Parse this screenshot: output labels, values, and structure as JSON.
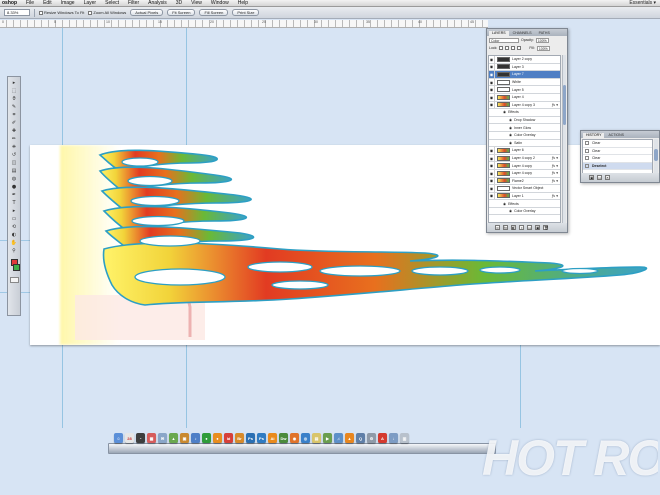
{
  "menubar": {
    "items": [
      "oshop",
      "File",
      "Edit",
      "Image",
      "Layer",
      "Select",
      "Filter",
      "Analysis",
      "3D",
      "View",
      "Window",
      "Help"
    ],
    "right": "Essentials ▾"
  },
  "options": {
    "zoom_value": "8.33%",
    "resize_windows_label": "Resize Windows To Fit",
    "zoom_all_windows_label": "Zoom All Windows",
    "buttons": [
      "Actual Pixels",
      "Fit Screen",
      "Fill Screen",
      "Print Size"
    ]
  },
  "ruler": {
    "labels": [
      "0",
      "5",
      "10",
      "15",
      "20",
      "25",
      "30",
      "35",
      "40",
      "45"
    ]
  },
  "tools": {
    "icons": [
      "move",
      "marquee",
      "lasso",
      "quick-select",
      "crop",
      "eyedropper",
      "healing",
      "brush",
      "stamp",
      "history-brush",
      "eraser",
      "gradient",
      "blur",
      "dodge",
      "pen",
      "type",
      "path-select",
      "shape",
      "3d-rotate",
      "3d-camera",
      "hand",
      "zoom"
    ],
    "glyphs": [
      "▸",
      "⬚",
      "ϑ",
      "✎",
      "⌗",
      "✐",
      "✚",
      "✏",
      "⎈",
      "↺",
      "◫",
      "▤",
      "◍",
      "●",
      "✒",
      "T",
      "▸",
      "▭",
      "⟲",
      "◐",
      "✋",
      "⚲"
    ],
    "fg_color": "#e0393b",
    "bg_color": "#3fae4a"
  },
  "layers_panel": {
    "tabs": [
      "LAYERS",
      "CHANNELS",
      "PATHS"
    ],
    "blend_mode": "Color",
    "opacity_label": "Opacity:",
    "opacity_value": "100%",
    "lock_label": "Lock:",
    "fill_label": "Fill:",
    "fill_value": "100%",
    "layers": [
      {
        "name": "Layer 2 copy",
        "thumb": "dark",
        "fx": false,
        "selected": false,
        "indent": 0
      },
      {
        "name": "Layer 3",
        "thumb": "dark",
        "fx": false,
        "selected": false,
        "indent": 0
      },
      {
        "name": "Layer 7",
        "thumb": "dark",
        "fx": false,
        "selected": true,
        "indent": 0
      },
      {
        "name": "White",
        "thumb": "plain",
        "fx": false,
        "selected": false,
        "indent": 0
      },
      {
        "name": "Layer 5",
        "thumb": "plain",
        "fx": false,
        "selected": false,
        "indent": 0
      },
      {
        "name": "Layer 4",
        "thumb": "color",
        "fx": false,
        "selected": false,
        "indent": 0
      },
      {
        "name": "Layer 4 copy 3",
        "thumb": "color",
        "fx": true,
        "selected": false,
        "indent": 0
      },
      {
        "name": "Effects",
        "thumb": "none",
        "fx": false,
        "selected": false,
        "indent": 1
      },
      {
        "name": "Drop Shadow",
        "thumb": "none",
        "fx": false,
        "selected": false,
        "indent": 2
      },
      {
        "name": "Inner Glow",
        "thumb": "none",
        "fx": false,
        "selected": false,
        "indent": 2
      },
      {
        "name": "Color Overlay",
        "thumb": "none",
        "fx": false,
        "selected": false,
        "indent": 2
      },
      {
        "name": "Satin",
        "thumb": "none",
        "fx": false,
        "selected": false,
        "indent": 2
      },
      {
        "name": "Layer 6",
        "thumb": "color",
        "fx": false,
        "selected": false,
        "indent": 0
      },
      {
        "name": "Layer 4 copy 2",
        "thumb": "color",
        "fx": true,
        "selected": false,
        "indent": 0
      },
      {
        "name": "Layer 4 copy",
        "thumb": "color",
        "fx": true,
        "selected": false,
        "indent": 0
      },
      {
        "name": "Layer 4 copy",
        "thumb": "color",
        "fx": true,
        "selected": false,
        "indent": 0
      },
      {
        "name": "Flame2",
        "thumb": "color",
        "fx": true,
        "selected": false,
        "indent": 0
      },
      {
        "name": "Vector Smart Object",
        "thumb": "plain",
        "fx": false,
        "selected": false,
        "indent": 0
      },
      {
        "name": "Layer 1",
        "thumb": "color",
        "fx": true,
        "selected": false,
        "indent": 0
      },
      {
        "name": "Effects",
        "thumb": "none",
        "fx": false,
        "selected": false,
        "indent": 1
      },
      {
        "name": "Color Overlay",
        "thumb": "none",
        "fx": false,
        "selected": false,
        "indent": 2
      }
    ],
    "footer_buttons": [
      "∞",
      "fx",
      "◧",
      "◑",
      "▭",
      "▣",
      "🗑"
    ]
  },
  "actions_panel": {
    "tabs": [
      "HISTORY",
      "ACTIONS"
    ],
    "rows": [
      {
        "label": "Clear",
        "selected": false
      },
      {
        "label": "Clear",
        "selected": false
      },
      {
        "label": "Clear",
        "selected": false
      },
      {
        "label": "Deselect",
        "selected": true
      }
    ]
  },
  "dock": {
    "icons": [
      {
        "name": "finder",
        "color": "#5b8fd8",
        "glyph": "☺"
      },
      {
        "name": "calendar",
        "color": "#e6e6e6",
        "glyph": "28"
      },
      {
        "name": "dashboard",
        "color": "#3d3d3d",
        "glyph": "◔"
      },
      {
        "name": "ical",
        "color": "#d65c5c",
        "glyph": "▦"
      },
      {
        "name": "mail",
        "color": "#8aa6c8",
        "glyph": "✉"
      },
      {
        "name": "preview",
        "color": "#6aa84f",
        "glyph": "▲"
      },
      {
        "name": "photo",
        "color": "#c9892f",
        "glyph": "▣"
      },
      {
        "name": "itunes",
        "color": "#4e7fc7",
        "glyph": "♪"
      },
      {
        "name": "chrome",
        "color": "#2f9c3a",
        "glyph": "●"
      },
      {
        "name": "illustrator-app",
        "color": "#e88d1f",
        "glyph": "●"
      },
      {
        "name": "indesign",
        "color": "#d6403a",
        "glyph": "Id"
      },
      {
        "name": "bridge",
        "color": "#d78a2a",
        "glyph": "Br"
      },
      {
        "name": "photoshop",
        "color": "#2a6fb3",
        "glyph": "Ps"
      },
      {
        "name": "photoshop2",
        "color": "#2f7bc2",
        "glyph": "Ps"
      },
      {
        "name": "illustrator",
        "color": "#e98a1c",
        "glyph": "Ai"
      },
      {
        "name": "dreamweaver",
        "color": "#4b8a3b",
        "glyph": "Dw"
      },
      {
        "name": "firefox",
        "color": "#e0732a",
        "glyph": "◉"
      },
      {
        "name": "safari",
        "color": "#3a80c9",
        "glyph": "◎"
      },
      {
        "name": "notes",
        "color": "#d9c56a",
        "glyph": "▤"
      },
      {
        "name": "facetime",
        "color": "#6b9e4f",
        "glyph": "▶"
      },
      {
        "name": "music",
        "color": "#5c8fc8",
        "glyph": "♫"
      },
      {
        "name": "vlc",
        "color": "#e8861f",
        "glyph": "▲"
      },
      {
        "name": "quicktime",
        "color": "#5f7fa8",
        "glyph": "Q"
      },
      {
        "name": "settings",
        "color": "#8f9aa8",
        "glyph": "⚙"
      },
      {
        "name": "acrobat",
        "color": "#d43a2f",
        "glyph": "A"
      },
      {
        "name": "downloads",
        "color": "#7d9cc4",
        "glyph": "↓"
      },
      {
        "name": "trash",
        "color": "#b8c1cc",
        "glyph": "▥"
      }
    ]
  },
  "watermark": {
    "text": "HOT ROD"
  }
}
